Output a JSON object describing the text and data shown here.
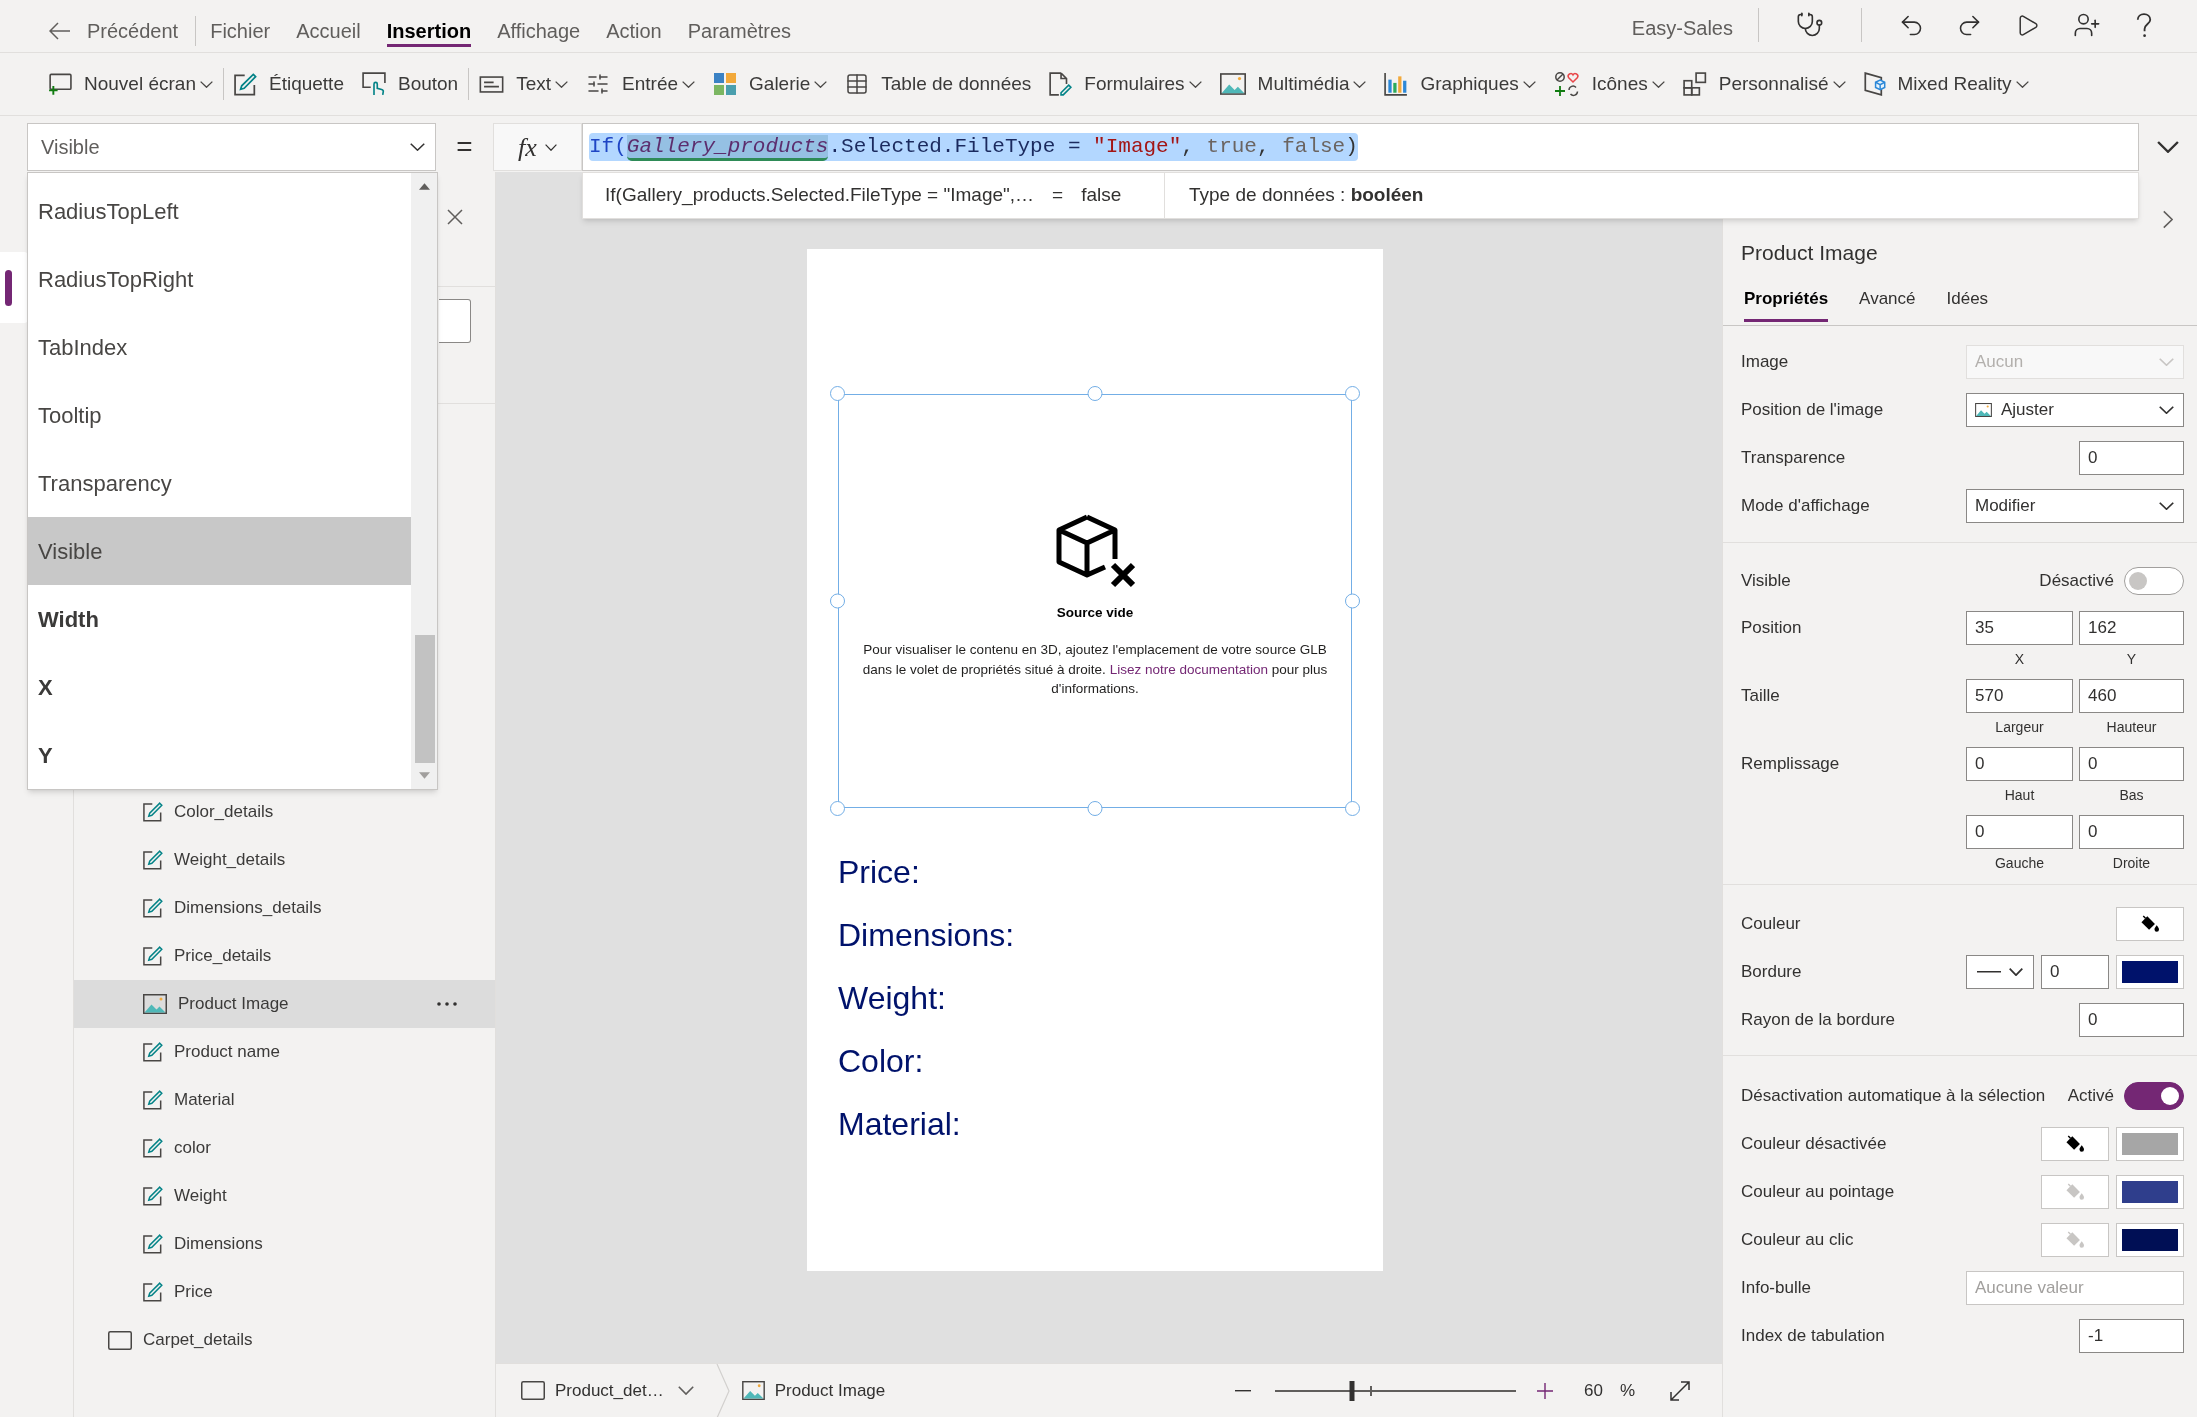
{
  "menu_bar": {
    "back": "Précédent",
    "tabs": [
      {
        "label": "Fichier",
        "selected": false
      },
      {
        "label": "Accueil",
        "selected": false
      },
      {
        "label": "Insertion",
        "selected": true
      },
      {
        "label": "Affichage",
        "selected": false
      },
      {
        "label": "Action",
        "selected": false
      },
      {
        "label": "Paramètres",
        "selected": false
      }
    ],
    "app_name": "Easy-Sales"
  },
  "toolbar": {
    "groups": [
      [
        {
          "kind": "new_screen",
          "label": "Nouvel écran",
          "dropdown": true
        }
      ],
      [
        {
          "kind": "label",
          "label": "Étiquette",
          "dropdown": false
        },
        {
          "kind": "button",
          "label": "Bouton",
          "dropdown": false
        }
      ],
      [
        {
          "kind": "text",
          "label": "Text",
          "dropdown": true
        },
        {
          "kind": "input",
          "label": "Entrée",
          "dropdown": true
        },
        {
          "kind": "gallery",
          "label": "Galerie",
          "dropdown": true
        },
        {
          "kind": "table",
          "label": "Table de données",
          "dropdown": false
        },
        {
          "kind": "forms",
          "label": "Formulaires",
          "dropdown": true
        },
        {
          "kind": "media",
          "label": "Multimédia",
          "dropdown": true
        },
        {
          "kind": "charts",
          "label": "Graphiques",
          "dropdown": true
        },
        {
          "kind": "icons",
          "label": "Icônes",
          "dropdown": true
        },
        {
          "kind": "custom",
          "label": "Personnalisé",
          "dropdown": true
        },
        {
          "kind": "mixed_reality",
          "label": "Mixed Reality",
          "dropdown": true
        }
      ]
    ]
  },
  "formula_bar": {
    "property": "Visible",
    "equals": "=",
    "fx": "fx",
    "selected": true,
    "tokens": [
      {
        "kind": "function",
        "text": "If("
      },
      {
        "kind": "control",
        "text": "Gallery_products"
      },
      {
        "kind": "member",
        "text": ".Selected.FileType = "
      },
      {
        "kind": "string",
        "text": "\"Image\""
      },
      {
        "kind": "punct",
        "text": ", "
      },
      {
        "kind": "literal",
        "text": "true"
      },
      {
        "kind": "punct",
        "text": ", "
      },
      {
        "kind": "literal",
        "text": "false"
      },
      {
        "kind": "punct",
        "text": ")"
      }
    ],
    "preview": {
      "expression": "If(Gallery_products.Selected.FileType = \"Image\",…",
      "equals": "=",
      "result": "false"
    },
    "data_type": "Type de données : **booléen**"
  },
  "property_list": {
    "items": [
      {
        "label": "RadiusTopLeft",
        "selected": false,
        "modified": false
      },
      {
        "label": "RadiusTopRight",
        "selected": false,
        "modified": false
      },
      {
        "label": "TabIndex",
        "selected": false,
        "modified": false
      },
      {
        "label": "Tooltip",
        "selected": false,
        "modified": false
      },
      {
        "label": "Transparency",
        "selected": false,
        "modified": false
      },
      {
        "label": "Visible",
        "selected": true,
        "modified": false
      },
      {
        "label": "Width",
        "selected": false,
        "modified": true
      },
      {
        "label": "X",
        "selected": false,
        "modified": true
      },
      {
        "label": "Y",
        "selected": false,
        "modified": true
      }
    ]
  },
  "side_rail": {
    "items": [
      {
        "selected": true
      }
    ]
  },
  "tree_panel": {
    "items": [
      {
        "kind": "group",
        "children": [
          {
            "kind": "label",
            "label": "Color_details",
            "selected": false
          },
          {
            "kind": "label",
            "label": "Weight_details",
            "selected": false
          },
          {
            "kind": "label",
            "label": "Dimensions_details",
            "selected": false
          },
          {
            "kind": "label",
            "label": "Price_details",
            "selected": false
          },
          {
            "kind": "image",
            "label": "Product Image",
            "selected": true
          },
          {
            "kind": "label",
            "label": "Product name",
            "selected": false
          },
          {
            "kind": "label",
            "label": "Material",
            "selected": false
          },
          {
            "kind": "label",
            "label": "color",
            "selected": false
          },
          {
            "kind": "label",
            "label": "Weight",
            "selected": false
          },
          {
            "kind": "label",
            "label": "Dimensions",
            "selected": false
          },
          {
            "kind": "label",
            "label": "Price",
            "selected": false
          }
        ]
      },
      {
        "kind": "screen",
        "label": "Carpet_details",
        "selected": false
      }
    ]
  },
  "canvas": {
    "image_control": {
      "selected": true,
      "title": "Source vide",
      "message": "Pour visualiser le contenu en 3D, ajoutez l'emplacement de votre source GLB dans le volet de propriétés situé à droite.",
      "link": "Lisez notre documentation",
      "message_end": "pour plus d'informations."
    },
    "labels": [
      "Price:",
      "Dimensions:",
      "Weight:",
      "Color:",
      "Material:"
    ]
  },
  "status_bar": {
    "breadcrumb": [
      {
        "kind": "screen",
        "label": "Product_det…",
        "dropdown": true
      },
      {
        "kind": "image",
        "label": "Product Image",
        "dropdown": false
      }
    ],
    "zoom": {
      "level": 0.32,
      "value": "60",
      "unit": "%"
    }
  },
  "properties_panel": {
    "title": "Product Image",
    "tabs": [
      {
        "label": "Propriétés",
        "selected": true
      },
      {
        "label": "Avancé",
        "selected": false
      },
      {
        "label": "Idées",
        "selected": false
      }
    ],
    "sections": [
      [
        {
          "kind": "dropdown",
          "label": "Image",
          "value": "Aucun",
          "disabled": true
        },
        {
          "kind": "picture_dropdown",
          "label": "Position de l'image",
          "value": "Ajuster",
          "disabled": false
        },
        {
          "kind": "input",
          "label": "Transparence",
          "value": "0"
        },
        {
          "kind": "dropdown",
          "label": "Mode d'affichage",
          "value": "Modifier",
          "disabled": false
        }
      ],
      [
        {
          "kind": "toggle",
          "label": "Visible",
          "state_text": "Désactivé",
          "on": false
        },
        {
          "kind": "pair",
          "label": "Position",
          "fields": [
            {
              "value": "35",
              "caption": "X"
            },
            {
              "value": "162",
              "caption": "Y"
            }
          ]
        },
        {
          "kind": "pair",
          "label": "Taille",
          "fields": [
            {
              "value": "570",
              "caption": "Largeur"
            },
            {
              "value": "460",
              "caption": "Hauteur"
            }
          ]
        },
        {
          "kind": "pair",
          "label": "Remplissage",
          "fields": [
            {
              "value": "0",
              "caption": "Haut"
            },
            {
              "value": "0",
              "caption": "Bas"
            }
          ]
        },
        {
          "kind": "pair",
          "fields": [
            {
              "value": "0",
              "caption": "Gauche"
            },
            {
              "value": "0",
              "caption": "Droite"
            }
          ]
        }
      ],
      [
        {
          "kind": "color",
          "label": "Couleur"
        },
        {
          "kind": "border",
          "label": "Bordure",
          "value": "0",
          "color": "#00126b"
        },
        {
          "kind": "input",
          "label": "Rayon de la bordure",
          "value": "0"
        }
      ],
      [
        {
          "kind": "toggle",
          "label": "Désactivation automatique à la sélection",
          "state_text": "Activé",
          "on": true
        },
        {
          "kind": "color_pair",
          "label": "Couleur désactivée",
          "disabled": false,
          "color": "#a6a6a6"
        },
        {
          "kind": "color_pair",
          "label": "Couleur au pointage",
          "disabled": true,
          "color": "#2f3e8c"
        },
        {
          "kind": "color_pair",
          "label": "Couleur au clic",
          "disabled": true,
          "color": "#000f55"
        },
        {
          "kind": "wide_input",
          "label": "Info-bulle",
          "placeholder": "Aucune valeur"
        },
        {
          "kind": "input",
          "label": "Index de tabulation",
          "value": "-1"
        }
      ]
    ]
  }
}
